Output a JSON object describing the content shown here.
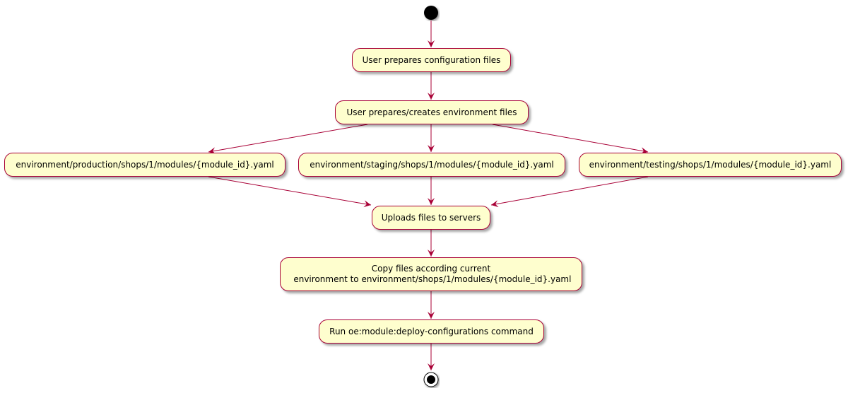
{
  "diagram": {
    "type": "activity",
    "colors": {
      "node_fill": "#FEFECE",
      "border": "#A80036",
      "arrow": "#A80036"
    },
    "start": "start",
    "end": "stop",
    "nodes": {
      "prepare_config": "User prepares configuration files",
      "prepare_env": "User prepares/creates environment files",
      "env_production": "environment/production/shops/1/modules/{module_id}.yaml",
      "env_staging": "environment/staging/shops/1/modules/{module_id}.yaml",
      "env_testing": "environment/testing/shops/1/modules/{module_id}.yaml",
      "upload": "Uploads files to servers",
      "copy": "Copy files according current\n environment to environment/shops/1/modules/{module_id}.yaml",
      "run": "Run oe:module:deploy-configurations command"
    },
    "edges": [
      [
        "start",
        "prepare_config"
      ],
      [
        "prepare_config",
        "prepare_env"
      ],
      [
        "prepare_env",
        "env_production"
      ],
      [
        "prepare_env",
        "env_staging"
      ],
      [
        "prepare_env",
        "env_testing"
      ],
      [
        "env_production",
        "upload"
      ],
      [
        "env_staging",
        "upload"
      ],
      [
        "env_testing",
        "upload"
      ],
      [
        "upload",
        "copy"
      ],
      [
        "copy",
        "run"
      ],
      [
        "run",
        "stop"
      ]
    ]
  }
}
